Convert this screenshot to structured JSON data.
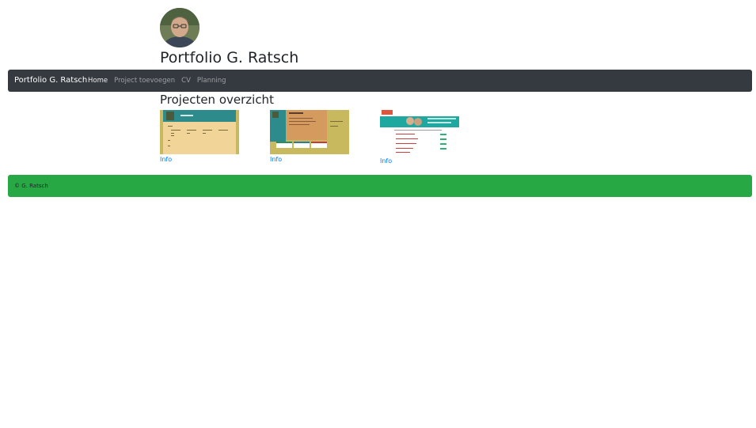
{
  "header": {
    "title": "Portfolio G. Ratsch"
  },
  "navbar": {
    "brand": "Portfolio G. Ratsch",
    "links": [
      {
        "label": "Home",
        "active": true
      },
      {
        "label": "Project toevoegen",
        "active": false
      },
      {
        "label": "CV",
        "active": false
      },
      {
        "label": "Planning",
        "active": false
      }
    ]
  },
  "main": {
    "section_title": "Projecten overzicht",
    "projects": [
      {
        "link_label": "Info"
      },
      {
        "link_label": "Info"
      },
      {
        "link_label": "Info"
      }
    ]
  },
  "footer": {
    "text": "© G. Ratsch"
  },
  "colors": {
    "navbar_bg": "#343a40",
    "footer_bg": "#28a745",
    "link": "#007bff"
  }
}
